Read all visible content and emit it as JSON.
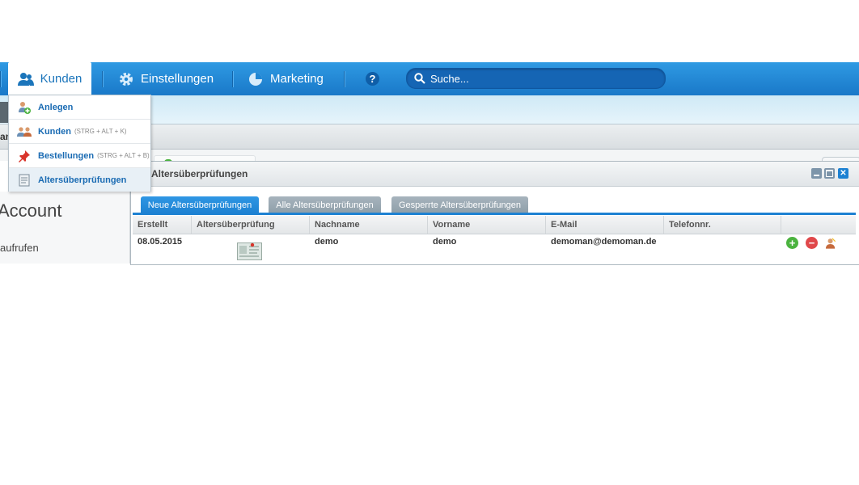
{
  "nav": {
    "kunden": "Kunden",
    "einstellungen": "Einstellungen",
    "marketing": "Marketing",
    "help_icon": "question-icon",
    "search_placeholder": "Suche..."
  },
  "dropdown": {
    "items": [
      {
        "label": "Anlegen",
        "shortcut": "",
        "icon": "add-customer-icon"
      },
      {
        "label": "Kunden",
        "shortcut": "(STRG + ALT + K)",
        "icon": "customers-icon"
      },
      {
        "label": "Bestellungen",
        "shortcut": "(STRG + ALT + B)",
        "icon": "pin-icon"
      },
      {
        "label": "Altersüberprüfungen",
        "shortcut": "",
        "icon": "document-icon"
      }
    ]
  },
  "background": {
    "left_cut_text": "an",
    "account_heading": "Account",
    "aufrufen_text": "aufrufen"
  },
  "window": {
    "title": "Altersüberprüfungen",
    "tabs": [
      {
        "label": "Neue Altersüberprüfungen",
        "active": true
      },
      {
        "label": "Alle Altersüberprüfungen",
        "active": false
      },
      {
        "label": "Gesperrte Altersüberprüfungen",
        "active": false
      }
    ],
    "columns": [
      "Erstellt",
      "Altersüberprüfung",
      "Nachname",
      "Vorname",
      "E-Mail",
      "Telefonnr.",
      ""
    ],
    "rows": [
      {
        "erstellt": "08.05.2015",
        "nachname": "demo",
        "vorname": "demo",
        "email": "demoman@demoman.de",
        "telefon": ""
      }
    ]
  },
  "colors": {
    "topbar": "#1f86d4",
    "active_tab": "#1d81d2",
    "inactive_tab": "#93a3ae",
    "link_blue": "#1a6bb3",
    "approve_green": "#4bb33f",
    "reject_red": "#e0484b"
  }
}
